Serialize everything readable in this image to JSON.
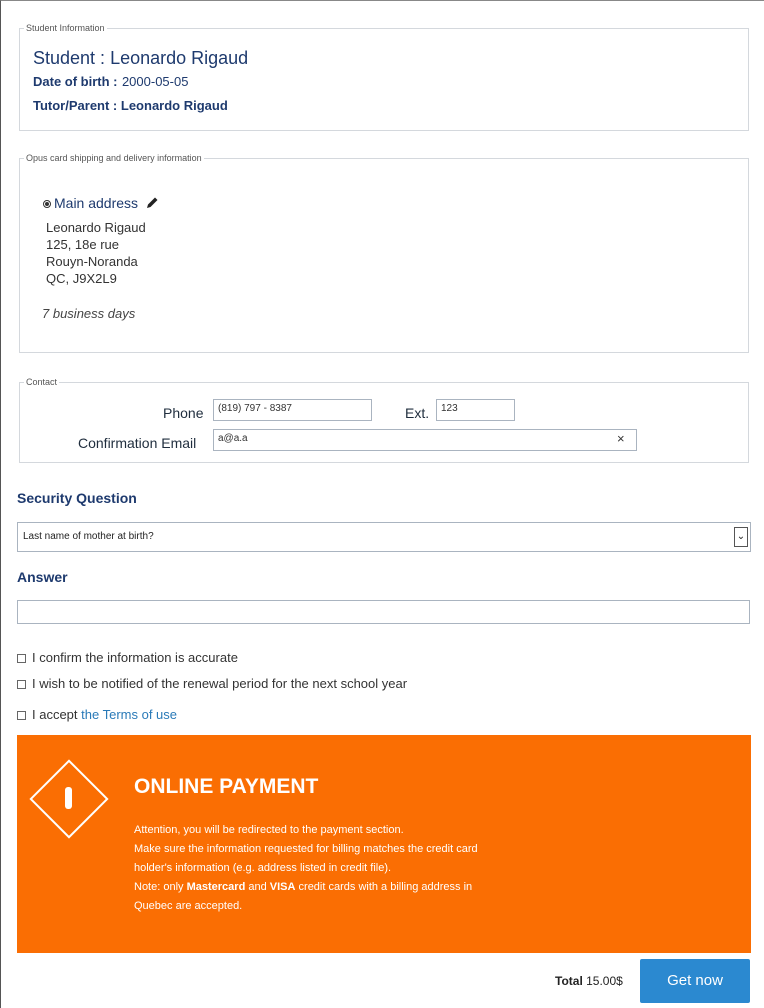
{
  "student_info": {
    "legend": "Student Information",
    "student_label": "Student :",
    "student_name": "Leonardo Rigaud",
    "dob_label": "Date of birth :",
    "dob_value": "2000-05-05",
    "tutor_label": "Tutor/Parent :",
    "tutor_name": "Leonardo Rigaud"
  },
  "shipping": {
    "legend": "Opus card shipping and delivery information",
    "main_address_label": "Main address",
    "address_lines": [
      "Leonardo Rigaud",
      "125, 18e rue",
      "Rouyn-Noranda",
      "QC, J9X2L9"
    ],
    "delivery_time": "7 business days"
  },
  "contact": {
    "legend": "Contact",
    "phone_label": "Phone",
    "phone_value": "(819) 797 - 8387",
    "ext_label": "Ext.",
    "ext_value": "123",
    "email_label": "Confirmation Email",
    "email_value": "a@a.a",
    "clear_glyph": "×"
  },
  "security": {
    "title": "Security Question",
    "selected": "Last name of mother at birth?",
    "arrow_glyph": "⌄",
    "answer_title": "Answer",
    "answer_value": ""
  },
  "checks": {
    "confirm": "I confirm the information is accurate",
    "notify": "I wish to be notified of the renewal period for the next school year",
    "accept_prefix": "I accept",
    "terms_link": "the Terms of use"
  },
  "payment": {
    "title": "ONLINE PAYMENT",
    "lines": [
      "Attention, you will be redirected to the payment section.",
      "Make sure the information requested for billing matches the credit card",
      "holder's information (e.g. address listed in credit file)."
    ],
    "note_prefix": "Note: only",
    "mastercard": "Mastercard",
    "and": "and",
    "visa": "VISA",
    "note_suffix": "credit cards with a billing address in",
    "note_last": "Quebec are accepted.",
    "color": "#fa6e03"
  },
  "footer": {
    "total_label": "Total",
    "total_value": "15.00$",
    "button_label": "Get now",
    "button_color": "#2b89d0"
  }
}
